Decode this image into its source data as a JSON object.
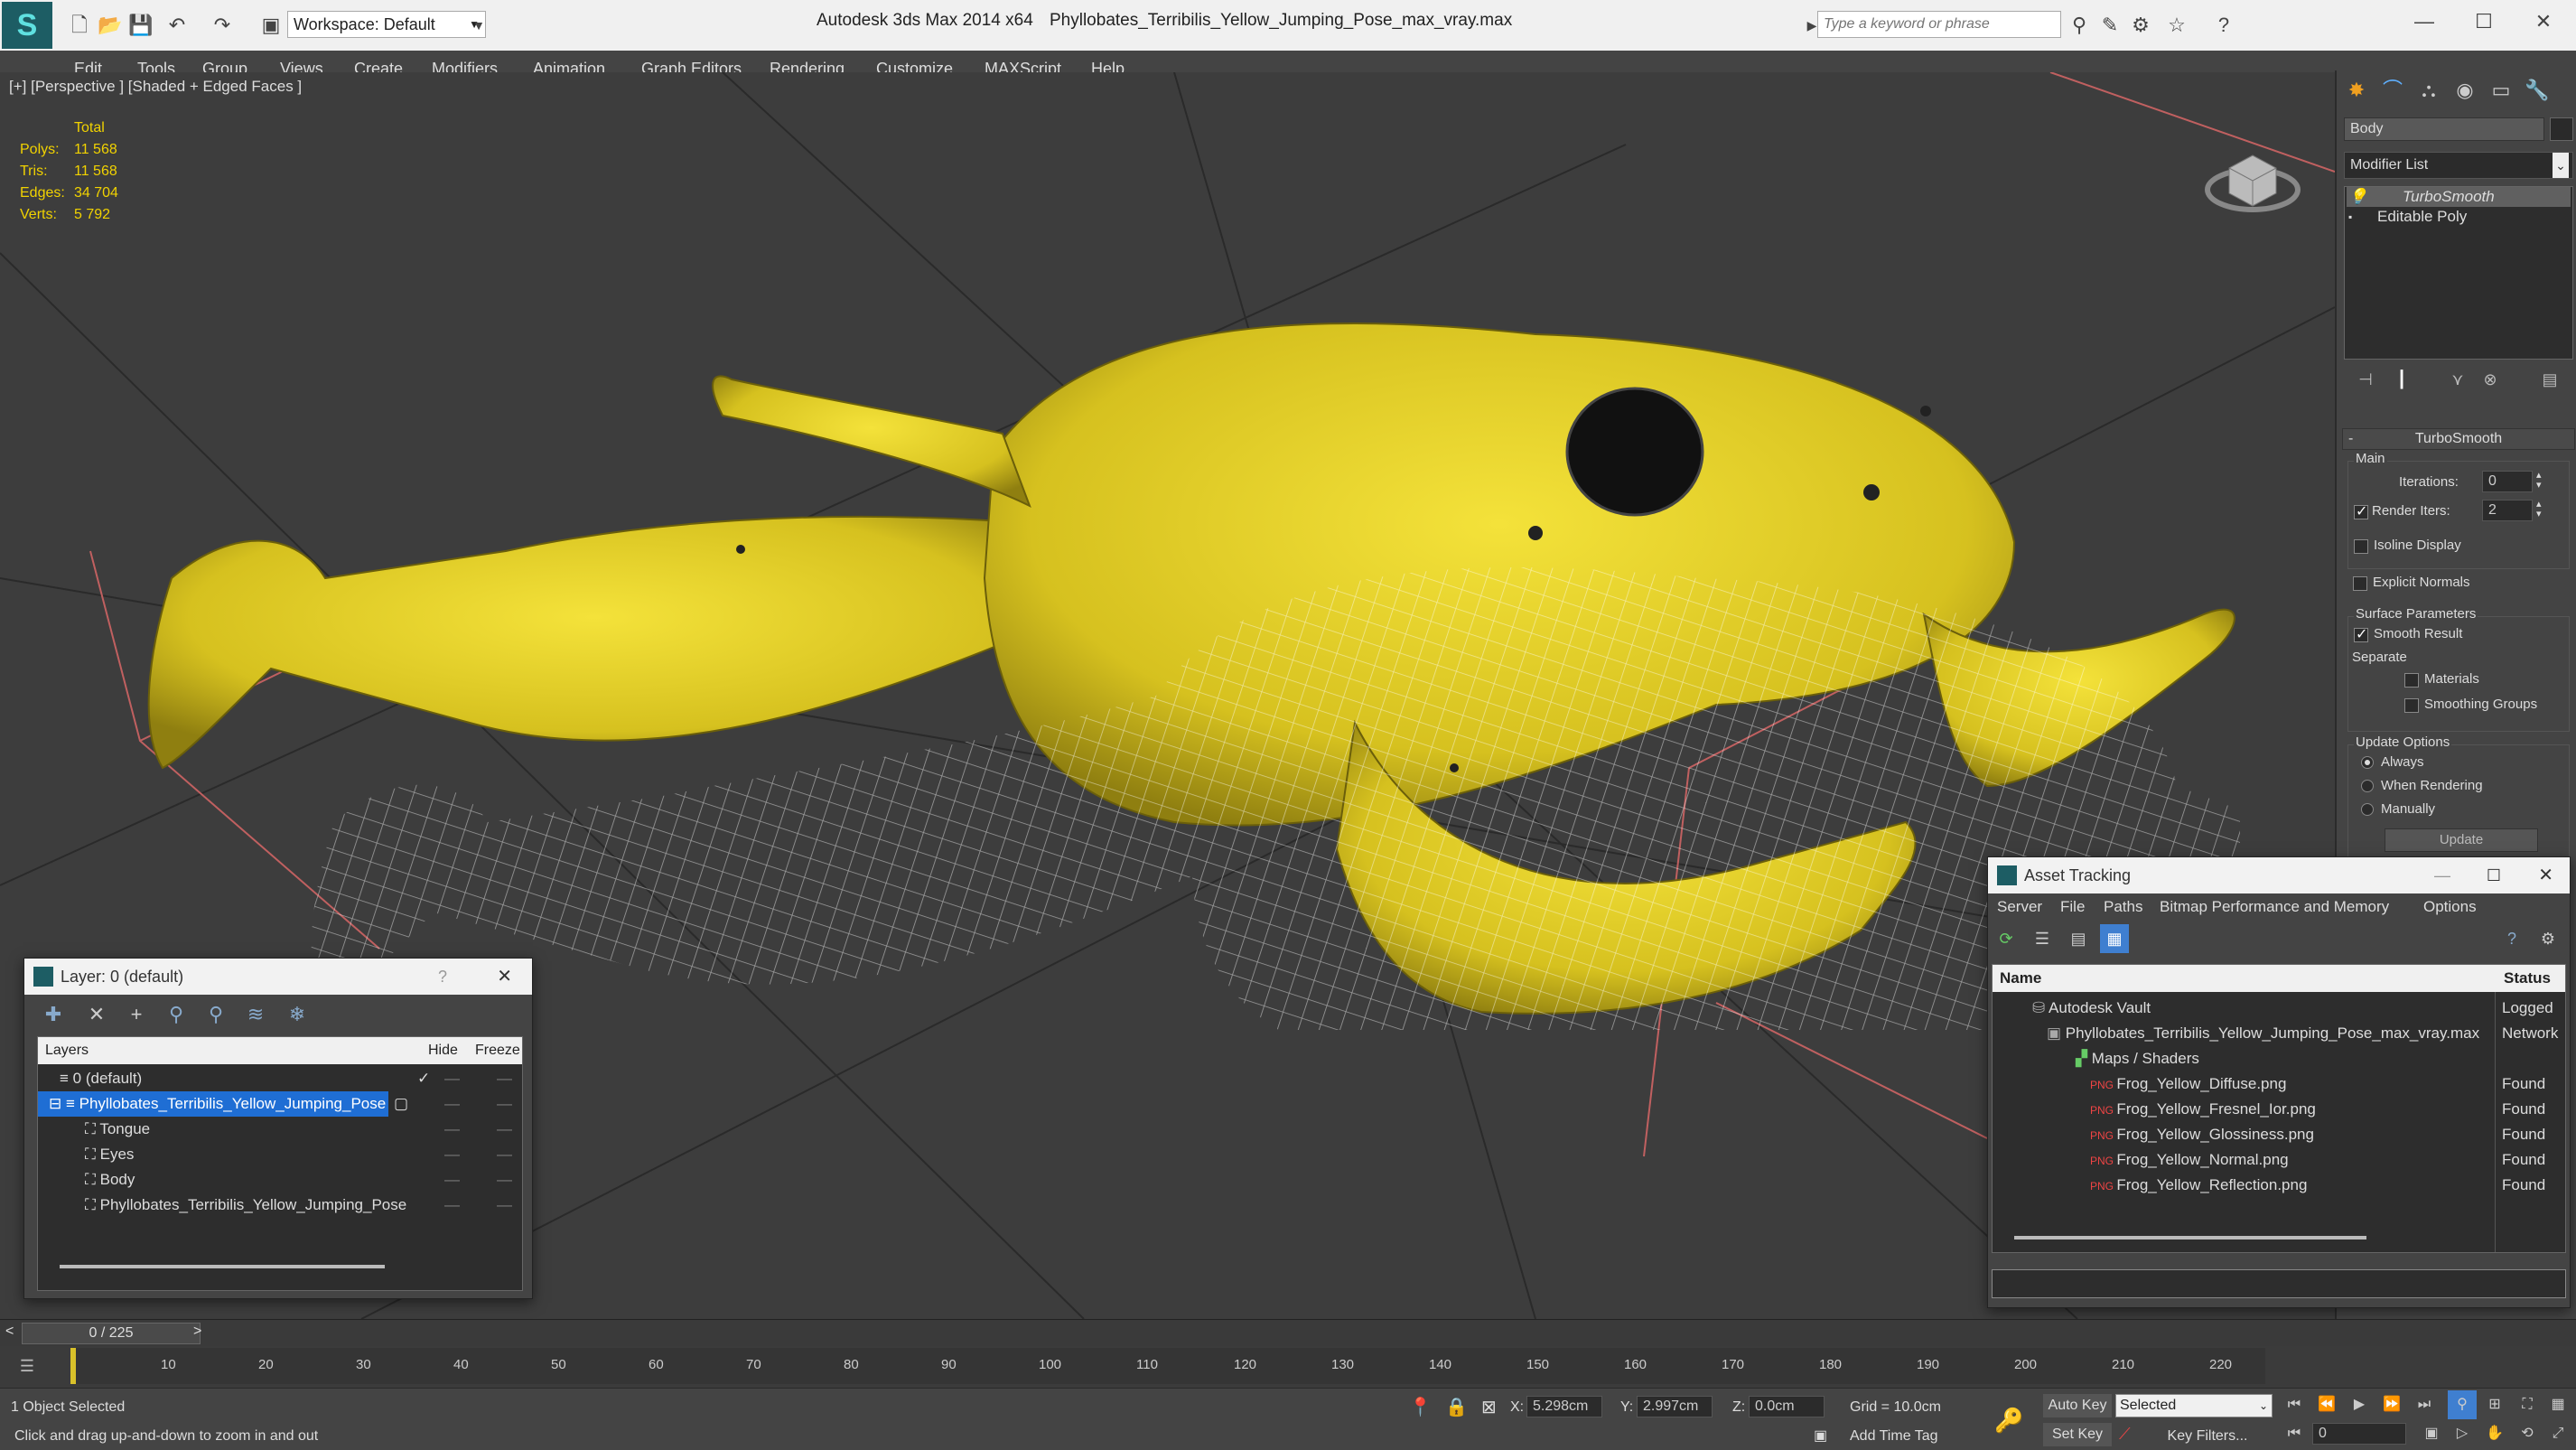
{
  "titlebar": {
    "app": "Autodesk 3ds Max  2014 x64",
    "file": "Phyllobates_Terribilis_Yellow_Jumping_Pose_max_vray.max",
    "workspace": "Workspace: Default",
    "search_placeholder": "Type a keyword or phrase"
  },
  "menu": [
    "Edit",
    "Tools",
    "Group",
    "Views",
    "Create",
    "Modifiers",
    "Animation",
    "Graph Editors",
    "Rendering",
    "Customize",
    "MAXScript",
    "Help"
  ],
  "viewport": {
    "label": "[+] [Perspective ] [Shaded + Edged Faces ]",
    "stats": {
      "header": "Total",
      "rows": [
        {
          "k": "Polys:",
          "v": "11 568"
        },
        {
          "k": "Tris:",
          "v": "11 568"
        },
        {
          "k": "Edges:",
          "v": "34 704"
        },
        {
          "k": "Verts:",
          "v": "5 792"
        }
      ]
    }
  },
  "command_panel": {
    "object_name": "Body",
    "modifier_list": "Modifier List",
    "stack": [
      "TurboSmooth",
      "Editable Poly"
    ],
    "rollout": {
      "title": "TurboSmooth",
      "main": "Main",
      "iterations_label": "Iterations:",
      "iterations": "0",
      "render_iters_label": "Render Iters:",
      "render_iters": "2",
      "isoline": "Isoline Display",
      "explicit": "Explicit Normals",
      "surface": "Surface Parameters",
      "smooth": "Smooth Result",
      "separate": "Separate",
      "materials": "Materials",
      "smoothing_groups": "Smoothing Groups",
      "update_options": "Update Options",
      "always": "Always",
      "when_rendering": "When Rendering",
      "manually": "Manually",
      "update": "Update"
    }
  },
  "layer_window": {
    "title": "Layer: 0 (default)",
    "help": "?",
    "col_layers": "Layers",
    "col_hide": "Hide",
    "col_freeze": "Freeze",
    "rows": [
      "0 (default)",
      "Phyllobates_Terribilis_Yellow_Jumping_Pose",
      "Tongue",
      "Eyes",
      "Body",
      "Phyllobates_Terribilis_Yellow_Jumping_Pose"
    ]
  },
  "asset_window": {
    "title": "Asset Tracking",
    "menu": [
      "Server",
      "File",
      "Paths",
      "Bitmap Performance and Memory",
      "Options"
    ],
    "col_name": "Name",
    "col_status": "Status",
    "rows": [
      {
        "name": "Autodesk Vault",
        "status": "Logged"
      },
      {
        "name": "Phyllobates_Terribilis_Yellow_Jumping_Pose_max_vray.max",
        "status": "Network"
      },
      {
        "name": "Maps / Shaders",
        "status": ""
      },
      {
        "name": "Frog_Yellow_Diffuse.png",
        "status": "Found"
      },
      {
        "name": "Frog_Yellow_Fresnel_Ior.png",
        "status": "Found"
      },
      {
        "name": "Frog_Yellow_Glossiness.png",
        "status": "Found"
      },
      {
        "name": "Frog_Yellow_Normal.png",
        "status": "Found"
      },
      {
        "name": "Frog_Yellow_Reflection.png",
        "status": "Found"
      }
    ]
  },
  "timeline": {
    "frame": "0 / 225",
    "ticks": [
      "10",
      "20",
      "30",
      "40",
      "50",
      "60",
      "70",
      "80",
      "90",
      "100",
      "110",
      "120",
      "130",
      "140",
      "150",
      "160",
      "170",
      "180",
      "190",
      "200",
      "210",
      "220"
    ]
  },
  "status": {
    "selected": "1 Object Selected",
    "prompt": "Click and drag up-and-down to zoom in and out",
    "x_label": "X:",
    "x": "5.298cm",
    "y_label": "Y:",
    "y": "2.997cm",
    "z_label": "Z:",
    "z": "0.0cm",
    "grid": "Grid = 10.0cm",
    "auto_key": "Auto Key",
    "set_key": "Set Key",
    "selected_dd": "Selected",
    "key_filters": "Key Filters...",
    "add_time_tag": "Add Time Tag",
    "frame_field": "0"
  }
}
